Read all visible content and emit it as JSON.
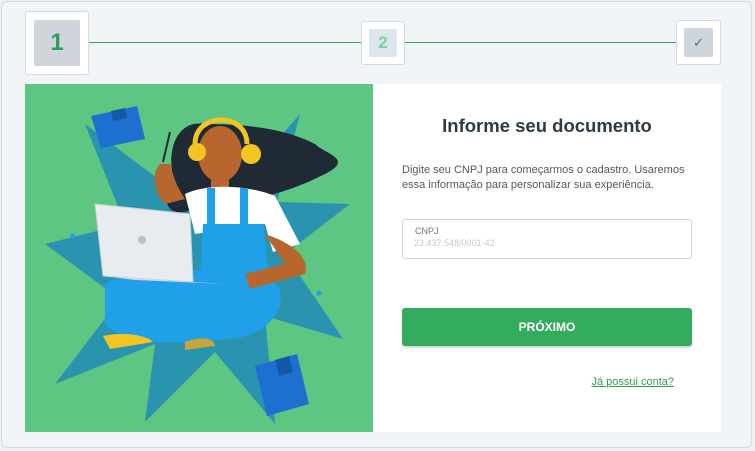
{
  "stepper": {
    "step1_label": "1",
    "step2_label": "2",
    "step3_label": "✓",
    "accent_color": "#34a563"
  },
  "form": {
    "title": "Informe seu documento",
    "description": "Digite seu CNPJ para começarmos o cadastro. Usaremos essa informação para personalizar sua experiência.",
    "cnpj_label": "CNPJ",
    "cnpj_placeholder": "23.437.548/0001-42",
    "submit_label": "PRÓXIMO",
    "login_link": "Já possui conta?"
  },
  "illustration": {
    "description_icon": "person-with-laptop-illustration",
    "background_color": "#5cc682"
  }
}
